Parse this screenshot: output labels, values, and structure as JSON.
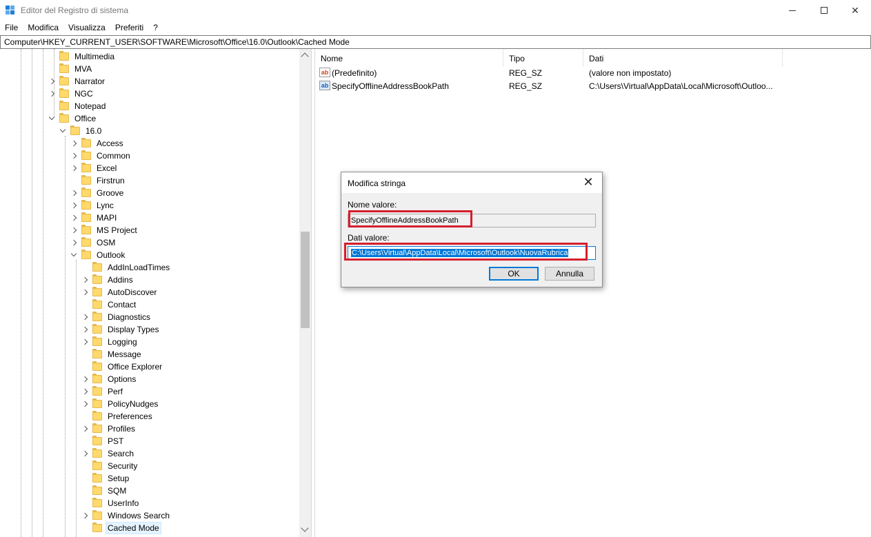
{
  "window": {
    "title": "Editor del Registro di sistema",
    "minimize_label": "",
    "close_glyph": "✕"
  },
  "menu": [
    "File",
    "Modifica",
    "Visualizza",
    "Preferiti",
    "?"
  ],
  "address": "Computer\\HKEY_CURRENT_USER\\SOFTWARE\\Microsoft\\Office\\16.0\\Outlook\\Cached Mode",
  "tree": {
    "level1": [
      {
        "label": "Multimedia",
        "expander": "none"
      },
      {
        "label": "MVA",
        "expander": "none"
      },
      {
        "label": "Narrator",
        "expander": "right"
      },
      {
        "label": "NGC",
        "expander": "right"
      },
      {
        "label": "Notepad",
        "expander": "none"
      },
      {
        "label": "Office",
        "expander": "down"
      }
    ],
    "level2": [
      {
        "label": "16.0",
        "expander": "down"
      }
    ],
    "level3": [
      {
        "label": "Access",
        "expander": "right"
      },
      {
        "label": "Common",
        "expander": "right"
      },
      {
        "label": "Excel",
        "expander": "right"
      },
      {
        "label": "Firstrun",
        "expander": "none"
      },
      {
        "label": "Groove",
        "expander": "right"
      },
      {
        "label": "Lync",
        "expander": "right"
      },
      {
        "label": "MAPI",
        "expander": "right"
      },
      {
        "label": "MS Project",
        "expander": "right"
      },
      {
        "label": "OSM",
        "expander": "right"
      },
      {
        "label": "Outlook",
        "expander": "down"
      }
    ],
    "level4": [
      {
        "label": "AddInLoadTimes",
        "expander": "none"
      },
      {
        "label": "Addins",
        "expander": "right"
      },
      {
        "label": "AutoDiscover",
        "expander": "right"
      },
      {
        "label": "Contact",
        "expander": "none"
      },
      {
        "label": "Diagnostics",
        "expander": "right"
      },
      {
        "label": "Display Types",
        "expander": "right"
      },
      {
        "label": "Logging",
        "expander": "right"
      },
      {
        "label": "Message",
        "expander": "none"
      },
      {
        "label": "Office Explorer",
        "expander": "none"
      },
      {
        "label": "Options",
        "expander": "right"
      },
      {
        "label": "Perf",
        "expander": "right"
      },
      {
        "label": "PolicyNudges",
        "expander": "right"
      },
      {
        "label": "Preferences",
        "expander": "none"
      },
      {
        "label": "Profiles",
        "expander": "right"
      },
      {
        "label": "PST",
        "expander": "none"
      },
      {
        "label": "Search",
        "expander": "right"
      },
      {
        "label": "Security",
        "expander": "none"
      },
      {
        "label": "Setup",
        "expander": "none"
      },
      {
        "label": "SQM",
        "expander": "none"
      },
      {
        "label": "UserInfo",
        "expander": "none"
      },
      {
        "label": "Windows Search",
        "expander": "right"
      },
      {
        "label": "Cached Mode",
        "expander": "none",
        "selected": true
      }
    ]
  },
  "values_pane": {
    "columns": [
      "Nome",
      "Tipo",
      "Dati"
    ],
    "rows": [
      {
        "icon": "string-value-icon",
        "name": "(Predefinito)",
        "type": "REG_SZ",
        "data": "(valore non impostato)"
      },
      {
        "icon": "string-value-icon",
        "name": "SpecifyOfflineAddressBookPath",
        "type": "REG_SZ",
        "data": "C:\\Users\\Virtual\\AppData\\Local\\Microsoft\\Outloo..."
      }
    ]
  },
  "dialog": {
    "title": "Modifica stringa",
    "name_label": "Nome valore:",
    "name_value": "SpecifyOfflineAddressBookPath",
    "data_label": "Dati valore:",
    "data_value": "C:\\Users\\Virtual\\AppData\\Local\\Microsoft\\Outlook\\NuovaRubrica",
    "ok_label": "OK",
    "cancel_label": "Annulla",
    "highlight_color": "#d61e2d",
    "selection_color": "#0078d7"
  }
}
